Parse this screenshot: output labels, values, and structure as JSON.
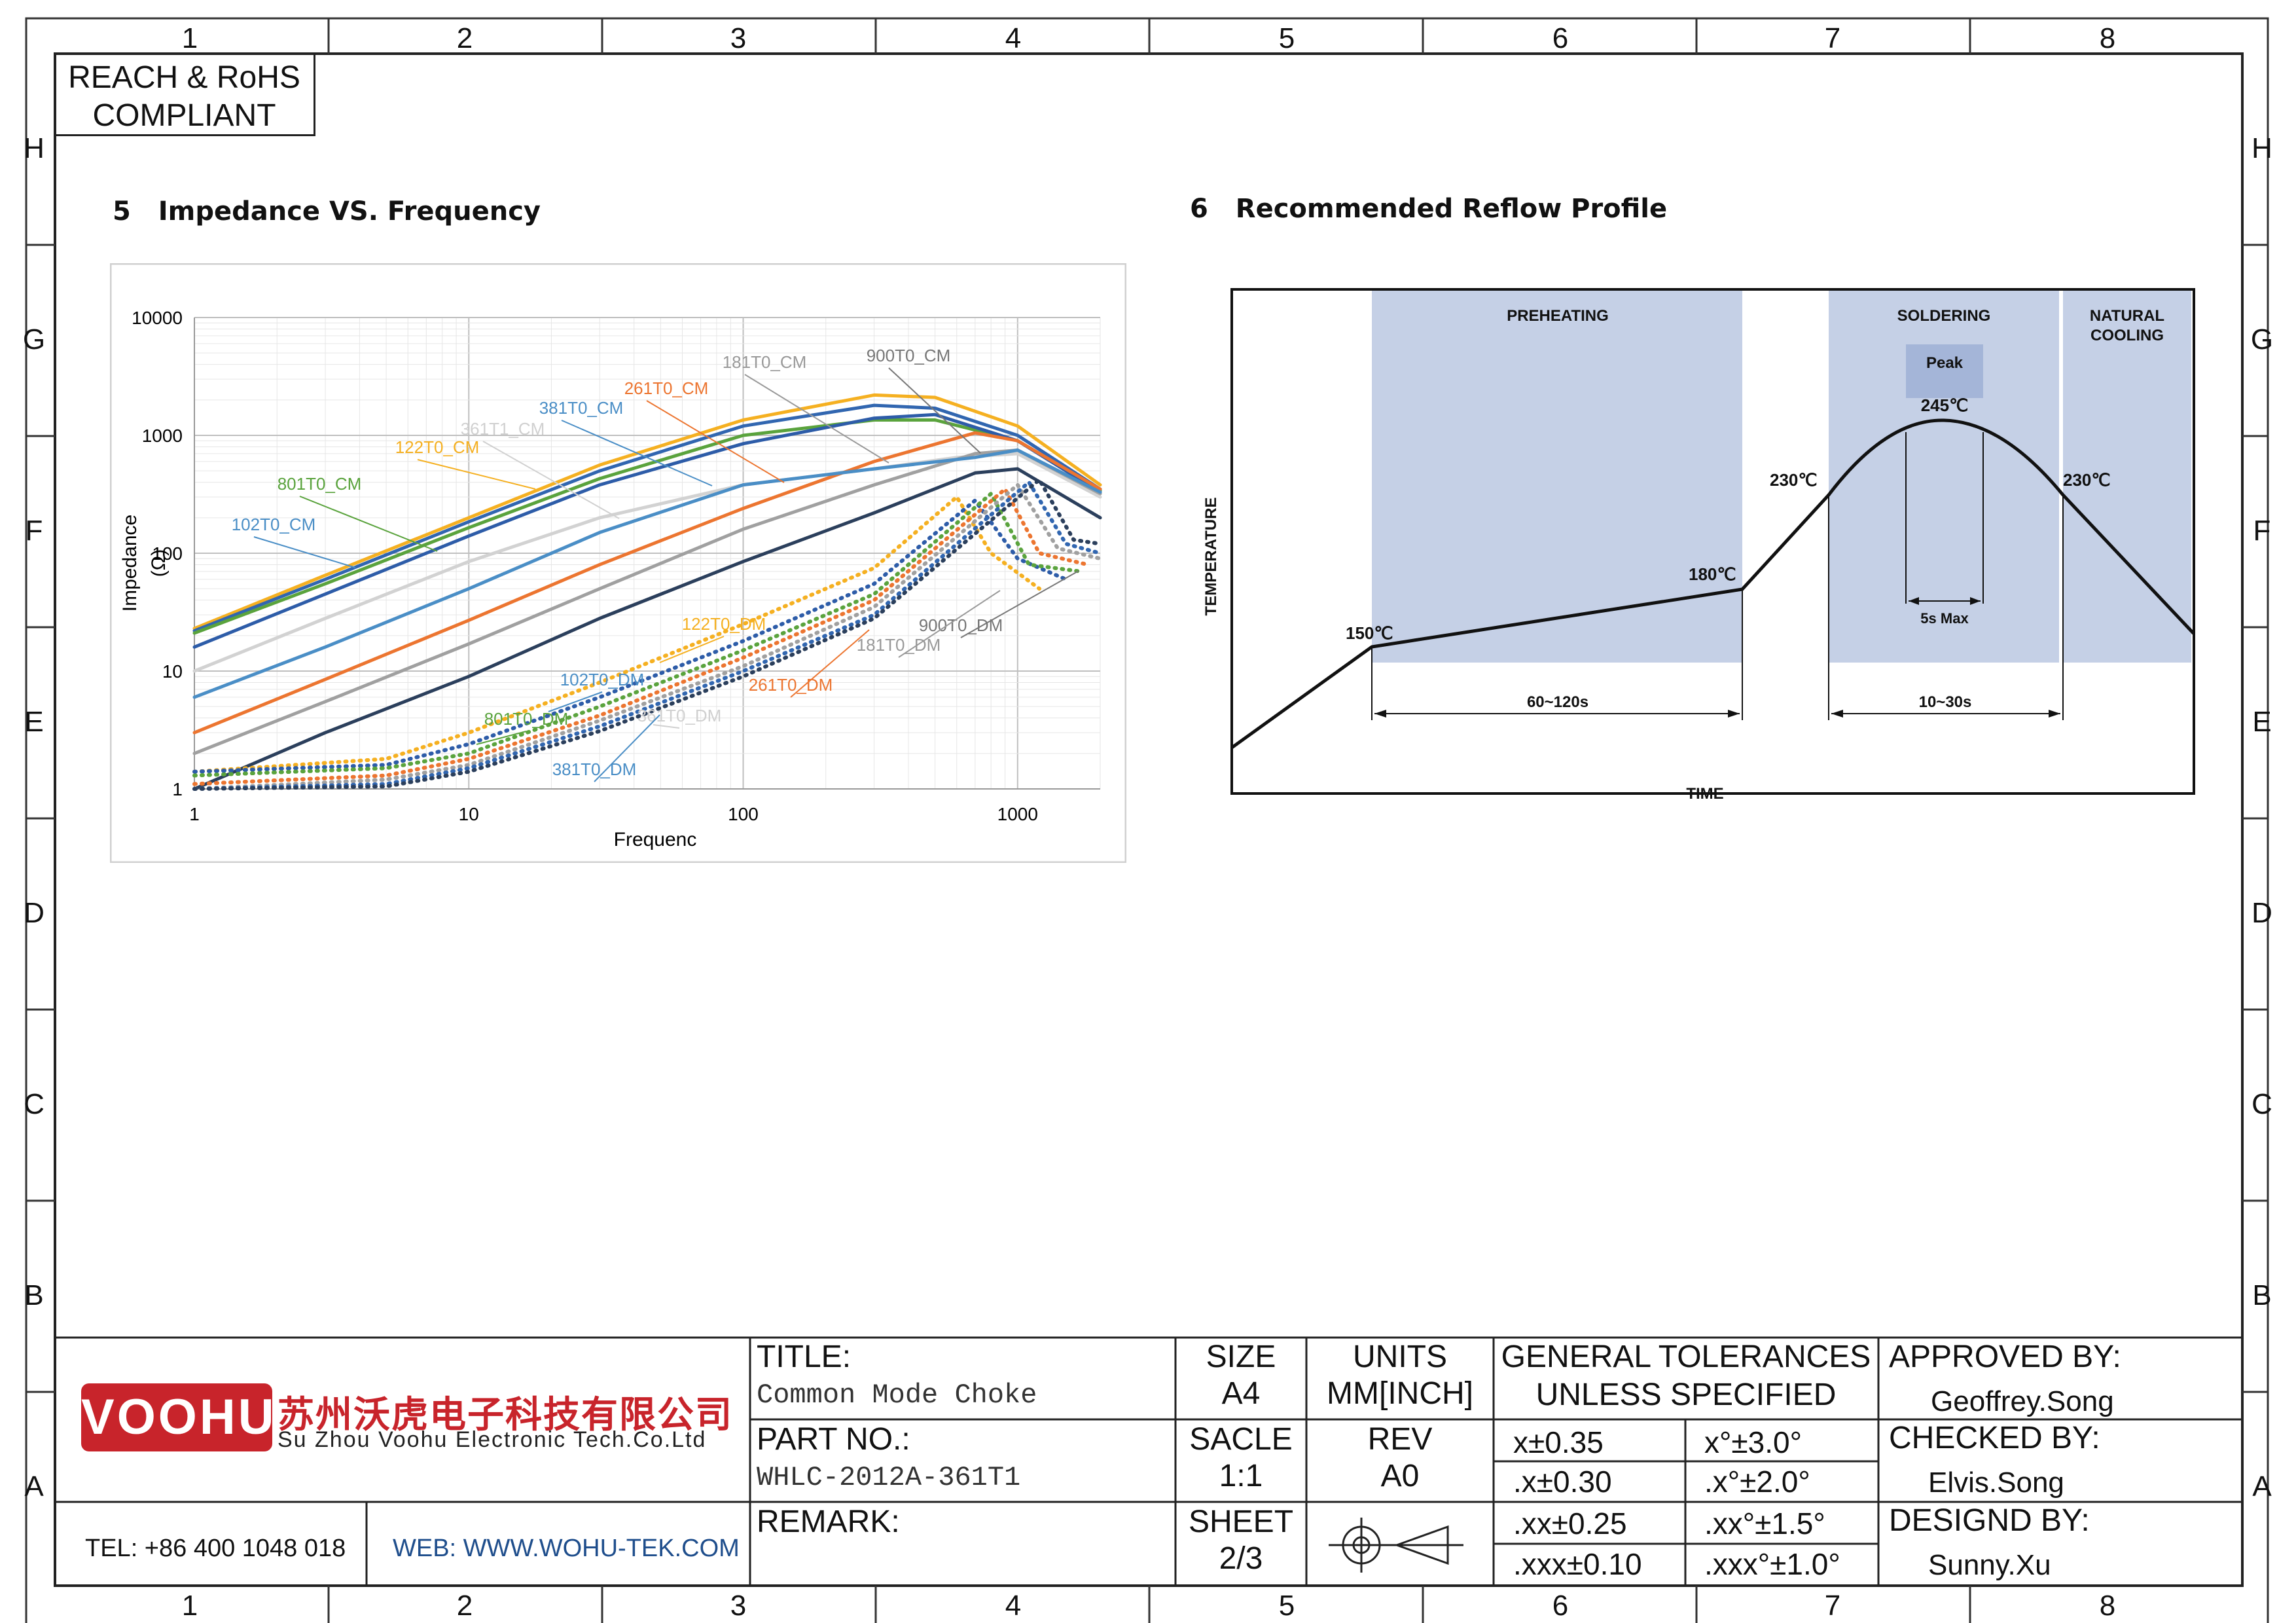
{
  "zones": {
    "cols": [
      "1",
      "2",
      "3",
      "4",
      "5",
      "6",
      "7",
      "8"
    ],
    "rows": [
      "H",
      "G",
      "F",
      "E",
      "D",
      "C",
      "B",
      "A"
    ]
  },
  "compliance": {
    "line1": "REACH & RoHS",
    "line2": "COMPLIANT"
  },
  "impedance": {
    "number": "5",
    "title": "Impedance VS. Frequency",
    "chart_data": {
      "type": "line",
      "xlabel": "Frequenc",
      "ylabel_line1": "Impedance",
      "ylabel_line2": "(Ω)",
      "x_scale": "log",
      "y_scale": "log",
      "xlim": [
        1,
        2000
      ],
      "ylim": [
        1,
        10000
      ],
      "xticks": [
        "1",
        "10",
        "100",
        "1000"
      ],
      "yticks": [
        "1",
        "10",
        "100",
        "1000",
        "10000"
      ],
      "grid": true,
      "series": [
        {
          "name": "122T0_CM",
          "color": "#f5b021",
          "style": "solid",
          "points": [
            [
              1,
              23
            ],
            [
              3,
              65
            ],
            [
              10,
              200
            ],
            [
              30,
              560
            ],
            [
              100,
              1350
            ],
            [
              300,
              2200
            ],
            [
              500,
              2100
            ],
            [
              1000,
              1200
            ],
            [
              2000,
              380
            ]
          ]
        },
        {
          "name": "381T0_CM",
          "color": "#3166b0",
          "style": "solid",
          "points": [
            [
              1,
              22
            ],
            [
              3,
              60
            ],
            [
              10,
              185
            ],
            [
              30,
              500
            ],
            [
              100,
              1200
            ],
            [
              300,
              1800
            ],
            [
              500,
              1700
            ],
            [
              1000,
              1000
            ],
            [
              2000,
              350
            ]
          ]
        },
        {
          "name": "801T0_CM",
          "color": "#5aa33d",
          "style": "solid",
          "points": [
            [
              1,
              21
            ],
            [
              3,
              55
            ],
            [
              10,
              165
            ],
            [
              30,
              430
            ],
            [
              100,
              1000
            ],
            [
              300,
              1350
            ],
            [
              500,
              1350
            ],
            [
              1000,
              900
            ],
            [
              2000,
              340
            ]
          ]
        },
        {
          "name": "102T0_CM",
          "color": "#2d5ca8",
          "style": "solid",
          "points": [
            [
              1,
              16
            ],
            [
              3,
              45
            ],
            [
              10,
              140
            ],
            [
              30,
              380
            ],
            [
              100,
              850
            ],
            [
              300,
              1400
            ],
            [
              500,
              1500
            ],
            [
              1000,
              900
            ],
            [
              2000,
              330
            ]
          ]
        },
        {
          "name": "361T1_CM",
          "color": "#d2d2d2",
          "style": "solid",
          "points": [
            [
              1,
              10
            ],
            [
              3,
              28
            ],
            [
              10,
              85
            ],
            [
              30,
              200
            ],
            [
              100,
              380
            ],
            [
              300,
              520
            ],
            [
              600,
              650
            ],
            [
              1000,
              700
            ],
            [
              2000,
              300
            ]
          ]
        },
        {
          "name": "261T0_CM",
          "color": "#ec7530",
          "style": "solid",
          "points": [
            [
              1,
              3
            ],
            [
              3,
              8.5
            ],
            [
              10,
              27
            ],
            [
              30,
              80
            ],
            [
              100,
              240
            ],
            [
              300,
              600
            ],
            [
              700,
              1050
            ],
            [
              1000,
              900
            ],
            [
              2000,
              350
            ]
          ]
        },
        {
          "name": "181T0_CM",
          "color": "#a0a0a0",
          "style": "solid",
          "points": [
            [
              1,
              2
            ],
            [
              3,
              5.5
            ],
            [
              10,
              17
            ],
            [
              30,
              50
            ],
            [
              100,
              160
            ],
            [
              300,
              380
            ],
            [
              700,
              700
            ],
            [
              1000,
              750
            ],
            [
              2000,
              320
            ]
          ]
        },
        {
          "name": "381T0_CM_blue",
          "color": "#4a8ec6",
          "style": "solid",
          "points": [
            [
              1,
              6
            ],
            [
              3,
              16
            ],
            [
              10,
              50
            ],
            [
              30,
              150
            ],
            [
              100,
              380
            ],
            [
              300,
              520
            ],
            [
              700,
              650
            ],
            [
              1000,
              750
            ],
            [
              2000,
              330
            ]
          ]
        },
        {
          "name": "900T0_CM",
          "color": "#2b3f5c",
          "style": "solid",
          "points": [
            [
              1,
              1
            ],
            [
              3,
              3
            ],
            [
              10,
              9
            ],
            [
              30,
              28
            ],
            [
              100,
              85
            ],
            [
              300,
              220
            ],
            [
              700,
              480
            ],
            [
              1000,
              520
            ],
            [
              2000,
              200
            ]
          ]
        },
        {
          "name": "122T0_DM",
          "color": "#f5b021",
          "style": "dotted",
          "points": [
            [
              1,
              1.4
            ],
            [
              5,
              1.8
            ],
            [
              10,
              3
            ],
            [
              30,
              8
            ],
            [
              100,
              25
            ],
            [
              300,
              75
            ],
            [
              600,
              300
            ],
            [
              800,
              100
            ],
            [
              1200,
              50
            ]
          ]
        },
        {
          "name": "102T0_DM",
          "color": "#2d5ca8",
          "style": "dotted",
          "points": [
            [
              1,
              1.4
            ],
            [
              5,
              1.6
            ],
            [
              10,
              2.4
            ],
            [
              30,
              6
            ],
            [
              100,
              18
            ],
            [
              300,
              55
            ],
            [
              700,
              280
            ],
            [
              1000,
              90
            ],
            [
              1500,
              60
            ]
          ]
        },
        {
          "name": "801T0_DM",
          "color": "#5aa33d",
          "style": "dotted",
          "points": [
            [
              1,
              1.3
            ],
            [
              5,
              1.5
            ],
            [
              10,
              2
            ],
            [
              30,
              5
            ],
            [
              100,
              15
            ],
            [
              300,
              45
            ],
            [
              800,
              320
            ],
            [
              1100,
              80
            ],
            [
              1700,
              70
            ]
          ]
        },
        {
          "name": "261T0_DM",
          "color": "#ec7530",
          "style": "dotted",
          "points": [
            [
              1,
              1.1
            ],
            [
              5,
              1.3
            ],
            [
              10,
              1.8
            ],
            [
              30,
              4.2
            ],
            [
              100,
              13
            ],
            [
              300,
              40
            ],
            [
              900,
              350
            ],
            [
              1200,
              100
            ],
            [
              1800,
              80
            ]
          ]
        },
        {
          "name": "181T0_DM",
          "color": "#a0a0a0",
          "style": "dotted",
          "points": [
            [
              1,
              1
            ],
            [
              5,
              1.2
            ],
            [
              10,
              1.6
            ],
            [
              30,
              3.8
            ],
            [
              100,
              11
            ],
            [
              300,
              35
            ],
            [
              1000,
              380
            ],
            [
              1400,
              110
            ],
            [
              2000,
              90
            ]
          ]
        },
        {
          "name": "381T0_DM",
          "color": "#3166b0",
          "style": "dotted",
          "points": [
            [
              1,
              1
            ],
            [
              5,
              1.1
            ],
            [
              10,
              1.5
            ],
            [
              30,
              3.4
            ],
            [
              100,
              10
            ],
            [
              300,
              30
            ],
            [
              1100,
              400
            ],
            [
              1500,
              120
            ],
            [
              2000,
              100
            ]
          ]
        },
        {
          "name": "900T0_DM",
          "color": "#2b3f5c",
          "style": "dotted",
          "points": [
            [
              1,
              1
            ],
            [
              5,
              1.05
            ],
            [
              10,
              1.4
            ],
            [
              30,
              3.1
            ],
            [
              100,
              9
            ],
            [
              300,
              28
            ],
            [
              1200,
              420
            ],
            [
              1600,
              130
            ],
            [
              2000,
              120
            ]
          ]
        }
      ],
      "annotations": [
        {
          "text": "900T0_CM",
          "color": "#777"
        },
        {
          "text": "181T0_CM",
          "color": "#999"
        },
        {
          "text": "261T0_CM",
          "color": "#ec7530"
        },
        {
          "text": "381T0_CM",
          "color": "#4a8ec6"
        },
        {
          "text": "361T1_CM",
          "color": "#d0d0d0"
        },
        {
          "text": "122T0_CM",
          "color": "#f5b021"
        },
        {
          "text": "801T0_CM",
          "color": "#5aa33d"
        },
        {
          "text": "102T0_CM",
          "color": "#4a8ec6"
        },
        {
          "text": "122T0_DM",
          "color": "#f5b021"
        },
        {
          "text": "102T0_DM",
          "color": "#4a8ec6"
        },
        {
          "text": "801T0_DM",
          "color": "#5aa33d"
        },
        {
          "text": "361T0_DM",
          "color": "#d0d0d0"
        },
        {
          "text": "261T0_DM",
          "color": "#ec7530"
        },
        {
          "text": "381T0_DM",
          "color": "#4a8ec6"
        },
        {
          "text": "900T0_DM",
          "color": "#777"
        },
        {
          "text": "181T0_DM",
          "color": "#999"
        }
      ]
    }
  },
  "reflow": {
    "number": "6",
    "title": "Recommended Reflow Profile",
    "ylabel": "TEMPERATURE",
    "xlabel": "TIME",
    "zone_preheat": "PREHEATING",
    "zone_solder": "SOLDERING",
    "zone_cool_1": "NATURAL",
    "zone_cool_2": "COOLING",
    "peak_label": "Peak",
    "peak_temp": "245℃",
    "t150": "150℃",
    "t180": "180℃",
    "t230_left": "230℃",
    "t230_right": "230℃",
    "dur_preheat": "60~120s",
    "dur_solder": "10~30s",
    "dur_peak": "5s Max",
    "colors": {
      "zone": "#c5d0e6",
      "peak": "#a4b5d8"
    }
  },
  "titleblock": {
    "company_logo": "VOOHU",
    "company_cn": "苏州沃虎电子科技有限公司",
    "company_en": "Su Zhou Voohu Electronic Tech.Co.Ltd",
    "tel": "TEL: +86 400 1048 018",
    "web": "WEB: WWW.WOHU-TEK.COM",
    "title_label": "TITLE:",
    "title_value": "Common Mode Choke",
    "partno_label": "PART NO.:",
    "partno_value": "WHLC-2012A-361T1",
    "remark_label": "REMARK:",
    "size_label": "SIZE",
    "size_value": "A4",
    "units_label": "UNITS",
    "units_value": "MM[INCH]",
    "scale_label": "SACLE",
    "scale_value": "1:1",
    "rev_label": "REV",
    "rev_value": "A0",
    "sheet_label": "SHEET",
    "sheet_value": "2/3",
    "tol_head_1": "GENERAL TOLERANCES",
    "tol_head_2": "UNLESS SPECIFIED",
    "tol": [
      [
        "x±0.35",
        "x°±3.0°"
      ],
      [
        ".x±0.30",
        ".x°±2.0°"
      ],
      [
        ".xx±0.25",
        ".xx°±1.5°"
      ],
      [
        ".xxx±0.10",
        ".xxx°±1.0°"
      ]
    ],
    "approved_label": "APPROVED BY:",
    "approved_value": "Geoffrey.Song",
    "checked_label": "CHECKED BY:",
    "checked_value": "Elvis.Song",
    "designed_label": "DESIGND BY:",
    "designed_value": "Sunny.Xu",
    "logo_color": "#c8242b",
    "web_color": "#1f4e8c"
  }
}
